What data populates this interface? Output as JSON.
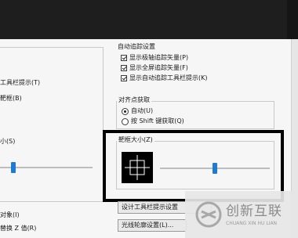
{
  "left_panel": {
    "tooltip_label": "工具栏提示(T)",
    "aperture_label": "靶框(B)",
    "size_label": "小(S)",
    "object_label": "对象(I)",
    "replace_z_label": "替换 Z 值(R)",
    "slider_value": 0.05
  },
  "autotrack": {
    "title": "自动追踪设置",
    "options": [
      {
        "label": "显示极轴追踪矢量(P)",
        "checked": true
      },
      {
        "label": "显示全屏追踪矢量(F)",
        "checked": true
      },
      {
        "label": "显示自动追踪工具栏提示(K)",
        "checked": true
      }
    ]
  },
  "alignment": {
    "title": "对齐点获取",
    "options": [
      {
        "label": "自动(U)",
        "selected": true
      },
      {
        "label": "按 Shift 键获取(Q)",
        "selected": false
      }
    ]
  },
  "aperture": {
    "title": "靶框大小(Z)",
    "slider_value": 0.5
  },
  "buttons": {
    "tooltip_settings": "设计工具栏提示设置",
    "light_glyph": "光线轮廓设置(L)..."
  },
  "watermark": {
    "title": "创新互联",
    "subtitle": "CHUANG XIN HU LIAN",
    "logo_glyph": "≈"
  },
  "colors": {
    "titlebar": "#1e1e1e",
    "slider_thumb": "#1e7bd4",
    "highlight_border": "#000000"
  }
}
